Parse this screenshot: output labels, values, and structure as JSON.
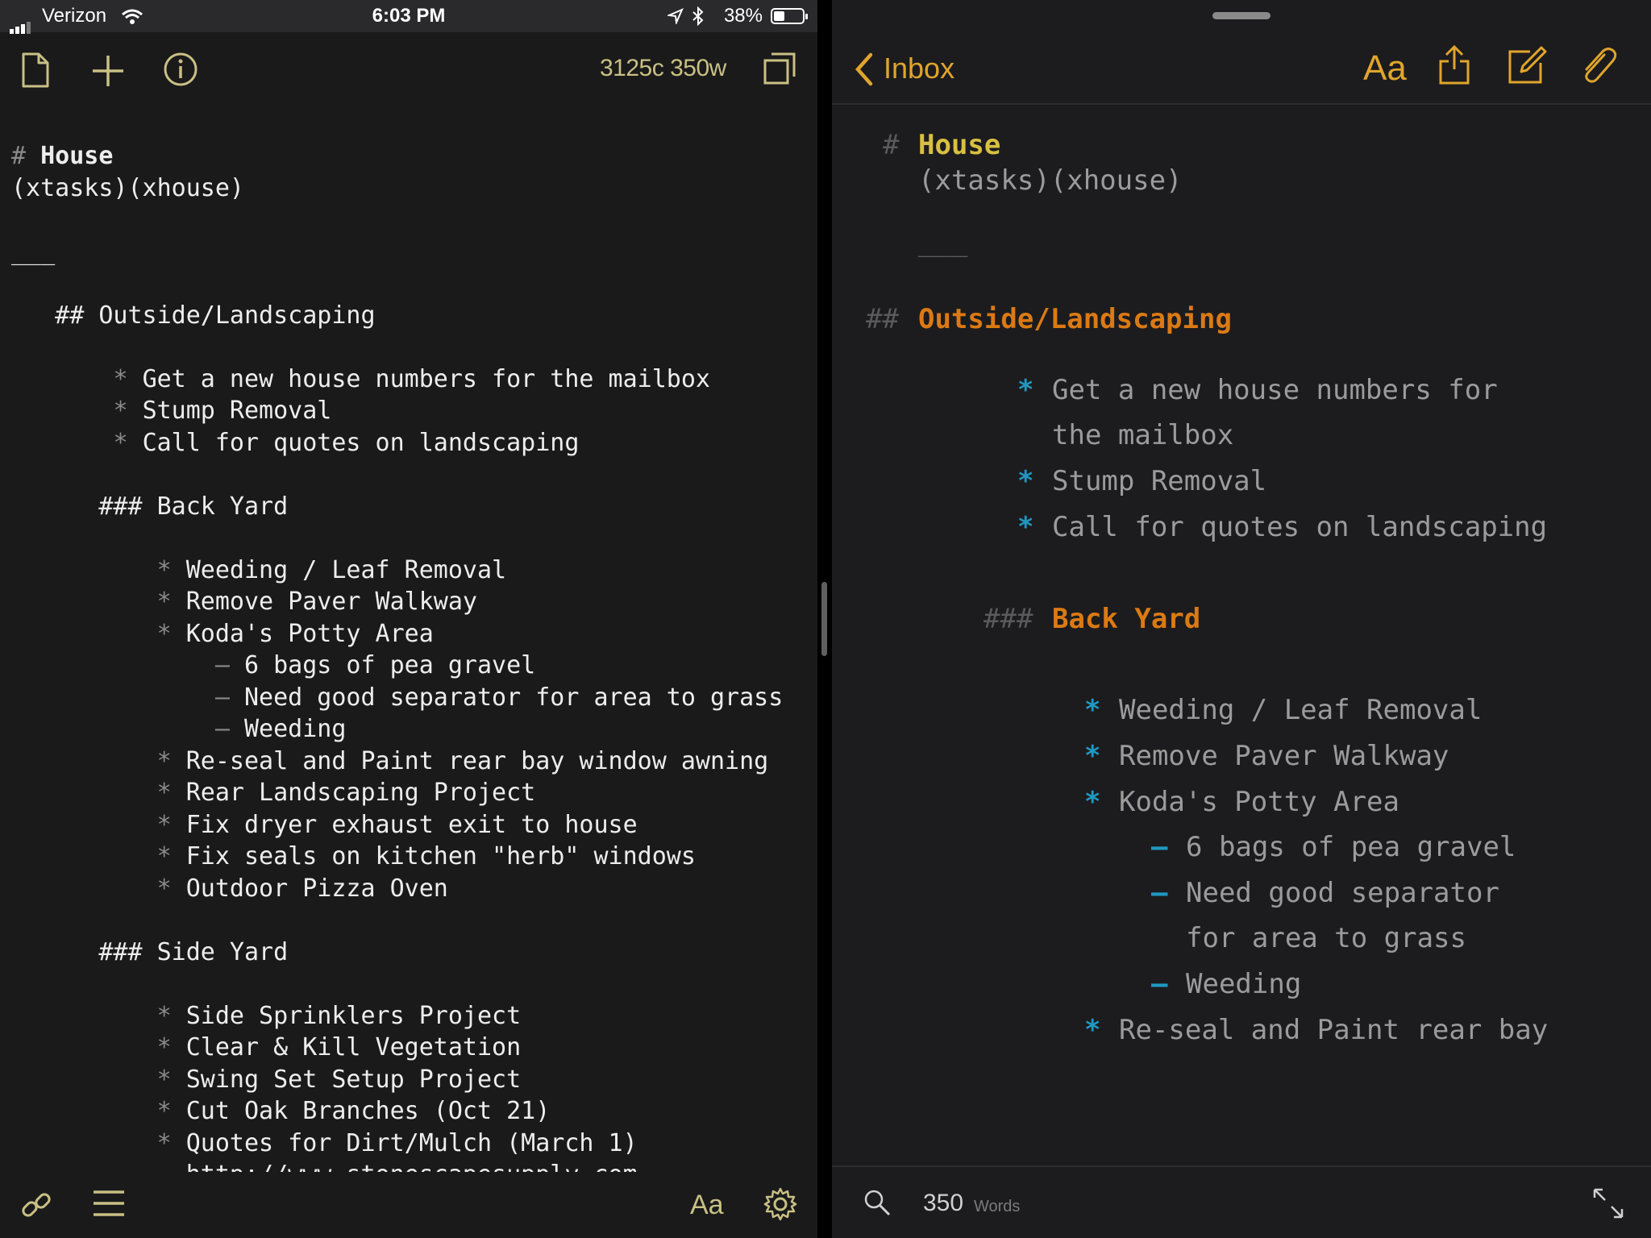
{
  "status_bar": {
    "carrier": "Verizon",
    "time": "6:03 PM",
    "battery": "38%"
  },
  "left_editor": {
    "counts": "3125c 350w",
    "lines": [
      {
        "mark": "# ",
        "text": "House",
        "bold": true
      },
      {
        "text": "(xtasks)(xhouse)"
      },
      {
        "text": ""
      },
      {
        "text": "___"
      },
      {
        "text": ""
      },
      {
        "text": "   ## Outside/Landscaping"
      },
      {
        "text": ""
      },
      {
        "indent": "       ",
        "mark": "* ",
        "text": "Get a new house numbers for the mailbox"
      },
      {
        "indent": "       ",
        "mark": "* ",
        "text": "Stump Removal"
      },
      {
        "indent": "       ",
        "mark": "* ",
        "text": "Call for quotes on landscaping"
      },
      {
        "text": ""
      },
      {
        "text": "      ### Back Yard"
      },
      {
        "text": ""
      },
      {
        "indent": "          ",
        "mark": "* ",
        "text": "Weeding / Leaf Removal"
      },
      {
        "indent": "          ",
        "mark": "* ",
        "text": "Remove Paver Walkway"
      },
      {
        "indent": "          ",
        "mark": "* ",
        "text": "Koda's Potty Area"
      },
      {
        "indent": "              ",
        "mark": "– ",
        "text": "6 bags of pea gravel"
      },
      {
        "indent": "              ",
        "mark": "– ",
        "text": "Need good separator for area to grass"
      },
      {
        "indent": "              ",
        "mark": "– ",
        "text": "Weeding"
      },
      {
        "indent": "          ",
        "mark": "* ",
        "text": "Re-seal and Paint rear bay window awning"
      },
      {
        "indent": "          ",
        "mark": "* ",
        "text": "Rear Landscaping Project"
      },
      {
        "indent": "          ",
        "mark": "* ",
        "text": "Fix dryer exhaust exit to house"
      },
      {
        "indent": "          ",
        "mark": "* ",
        "text": "Fix seals on kitchen \"herb\" windows"
      },
      {
        "indent": "          ",
        "mark": "* ",
        "text": "Outdoor Pizza Oven"
      },
      {
        "text": ""
      },
      {
        "text": "      ### Side Yard"
      },
      {
        "text": ""
      },
      {
        "indent": "          ",
        "mark": "* ",
        "text": "Side Sprinklers Project"
      },
      {
        "indent": "          ",
        "mark": "* ",
        "text": "Clear & Kill Vegetation"
      },
      {
        "indent": "          ",
        "mark": "* ",
        "text": "Swing Set Setup Project"
      },
      {
        "indent": "          ",
        "mark": "* ",
        "text": "Cut Oak Branches (Oct 21)"
      },
      {
        "indent": "          ",
        "mark": "* ",
        "text": "Quotes for Dirt/Mulch (March 1)"
      },
      {
        "indent": "            ",
        "text": "http://www.stonescapesupply.com"
      }
    ],
    "font_label": "Aa"
  },
  "right_preview": {
    "back_label": "Inbox",
    "font_label": "Aa",
    "h1_mark": "#",
    "h1": "House",
    "tags": "(xtasks)(xhouse)",
    "rule": "___",
    "h2_mark": "##",
    "h2": "Outside/Landscaping",
    "outside_items": [
      "Get a new house numbers for",
      "the mailbox",
      "Stump Removal",
      "Call for quotes on landscaping"
    ],
    "h3_mark": "###",
    "h3": "Back Yard",
    "backyard_items": [
      "Weeding / Leaf Removal",
      "Remove Paver Walkway",
      "Koda's Potty Area"
    ],
    "potty_items": [
      "6 bags of pea gravel",
      "Need good separator",
      "for area to grass",
      "Weeding"
    ],
    "last_item": "Re-seal and Paint rear bay",
    "bullet": "*",
    "dash": "–",
    "word_count": "350",
    "word_label": "Words"
  },
  "colors": {
    "accent": "#e0a52c",
    "left_icon": "#c9c084",
    "h1": "#d8c040",
    "h2": "#db7a14",
    "bullet": "#1f98c2"
  }
}
